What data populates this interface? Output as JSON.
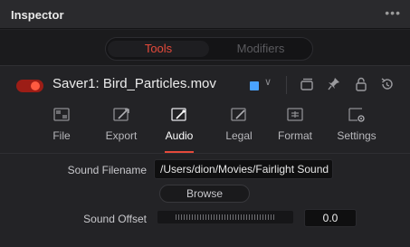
{
  "panel": {
    "title": "Inspector",
    "menu_glyph": "•••"
  },
  "segments": {
    "tools_label": "Tools",
    "modifiers_label": "Modifiers"
  },
  "node": {
    "name": "Saver1: Bird_Particles.mov",
    "enabled": true,
    "color_chip": "#4aa3ff",
    "chevron": "∨"
  },
  "tabs": [
    {
      "label": "File",
      "icon": "file-icon"
    },
    {
      "label": "Export",
      "icon": "export-icon"
    },
    {
      "label": "Audio",
      "icon": "audio-icon",
      "active": true
    },
    {
      "label": "Legal",
      "icon": "legal-icon"
    },
    {
      "label": "Format",
      "icon": "format-icon"
    },
    {
      "label": "Settings",
      "icon": "settings-icon"
    }
  ],
  "audio": {
    "sound_filename_label": "Sound Filename",
    "sound_filename_value": "/Users/dion/Movies/Fairlight Sound",
    "browse_label": "Browse",
    "sound_offset_label": "Sound Offset",
    "sound_offset_value": "0.0"
  },
  "colors": {
    "accent": "#e64a3b",
    "toggle_on": "#ff5a40"
  }
}
